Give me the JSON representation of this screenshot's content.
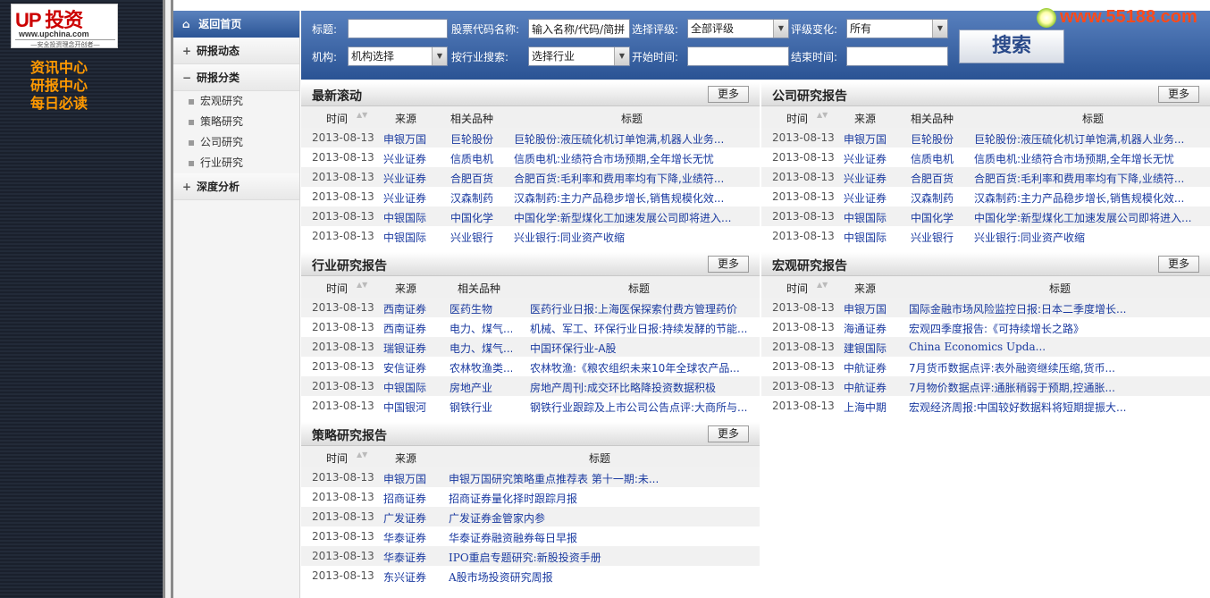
{
  "logo": {
    "brand_cn": "投资",
    "url": "www.upchina.com",
    "slogan": "—安全投资理念开创者—"
  },
  "left_nav": [
    "资讯中心",
    "研报中心",
    "每日必读"
  ],
  "brand_site": "www.55188.com",
  "menu": {
    "home": "返回首页",
    "groups": [
      {
        "label": "研报动态",
        "sign": "+"
      },
      {
        "label": "研报分类",
        "sign": "−"
      }
    ],
    "subitems": [
      "宏观研究",
      "策略研究",
      "公司研究",
      "行业研究"
    ],
    "deep": {
      "label": "深度分析",
      "sign": "+"
    }
  },
  "search": {
    "title_label": "标题:",
    "stock_label": "股票代码名称:",
    "stock_placeholder": "输入名称/代码/简拼",
    "rating_label": "选择评级:",
    "rating_value": "全部评级",
    "rating_change_label": "评级变化:",
    "rating_change_value": "所有",
    "org_label": "机构:",
    "org_value": "机构选择",
    "industry_label": "按行业搜索:",
    "industry_value": "选择行业",
    "start_label": "开始时间:",
    "end_label": "结束时间:",
    "button": "搜索"
  },
  "more_label": "更多",
  "headers": {
    "time": "时间",
    "source": "来源",
    "product": "相关品种",
    "title": "标题"
  },
  "panels": {
    "latest": {
      "title": "最新滚动",
      "rows": [
        {
          "date": "2013-08-13",
          "source": "申银万国",
          "product": "巨轮股份",
          "title": "巨轮股份:液压硫化机订单饱满,机器人业务..."
        },
        {
          "date": "2013-08-13",
          "source": "兴业证券",
          "product": "信质电机",
          "title": "信质电机:业绩符合市场预期,全年增长无忧"
        },
        {
          "date": "2013-08-13",
          "source": "兴业证券",
          "product": "合肥百货",
          "title": "合肥百货:毛利率和费用率均有下降,业绩符..."
        },
        {
          "date": "2013-08-13",
          "source": "兴业证券",
          "product": "汉森制药",
          "title": "汉森制药:主力产品稳步增长,销售规模化效..."
        },
        {
          "date": "2013-08-13",
          "source": "中银国际",
          "product": "中国化学",
          "title": "中国化学:新型煤化工加速发展公司即将进入..."
        },
        {
          "date": "2013-08-13",
          "source": "中银国际",
          "product": "兴业银行",
          "title": "兴业银行:同业资产收缩"
        }
      ]
    },
    "company": {
      "title": "公司研究报告",
      "rows": [
        {
          "date": "2013-08-13",
          "source": "申银万国",
          "product": "巨轮股份",
          "title": "巨轮股份:液压硫化机订单饱满,机器人业务..."
        },
        {
          "date": "2013-08-13",
          "source": "兴业证券",
          "product": "信质电机",
          "title": "信质电机:业绩符合市场预期,全年增长无忧"
        },
        {
          "date": "2013-08-13",
          "source": "兴业证券",
          "product": "合肥百货",
          "title": "合肥百货:毛利率和费用率均有下降,业绩符..."
        },
        {
          "date": "2013-08-13",
          "source": "兴业证券",
          "product": "汉森制药",
          "title": "汉森制药:主力产品稳步增长,销售规模化效..."
        },
        {
          "date": "2013-08-13",
          "source": "中银国际",
          "product": "中国化学",
          "title": "中国化学:新型煤化工加速发展公司即将进入..."
        },
        {
          "date": "2013-08-13",
          "source": "中银国际",
          "product": "兴业银行",
          "title": "兴业银行:同业资产收缩"
        }
      ]
    },
    "industry": {
      "title": "行业研究报告",
      "rows": [
        {
          "date": "2013-08-13",
          "source": "西南证券",
          "product": "医药生物",
          "title": "医药行业日报:上海医保探索付费方管理药价"
        },
        {
          "date": "2013-08-13",
          "source": "西南证券",
          "product": "电力、煤气...",
          "title": "机械、军工、环保行业日报:持续发酵的节能..."
        },
        {
          "date": "2013-08-13",
          "source": "瑞银证券",
          "product": "电力、煤气...",
          "title": "中国环保行业-A股"
        },
        {
          "date": "2013-08-13",
          "source": "安信证券",
          "product": "农林牧渔类...",
          "title": "农林牧渔:《粮农组织未来10年全球农产品..."
        },
        {
          "date": "2013-08-13",
          "source": "中银国际",
          "product": "房地产业",
          "title": "房地产周刊:成交环比略降投资数据积极"
        },
        {
          "date": "2013-08-13",
          "source": "中国银河",
          "product": "钢铁行业",
          "title": "钢铁行业跟踪及上市公司公告点评:大商所与..."
        }
      ]
    },
    "macro": {
      "title": "宏观研究报告",
      "rows": [
        {
          "date": "2013-08-13",
          "source": "申银万国",
          "title": "国际金融市场风险监控日报:日本二季度增长..."
        },
        {
          "date": "2013-08-13",
          "source": "海通证券",
          "title": "宏观四季度报告:《可持续增长之路》"
        },
        {
          "date": "2013-08-13",
          "source": "建银国际",
          "title": "China Economics Upda..."
        },
        {
          "date": "2013-08-13",
          "source": "中航证券",
          "title": "7月货币数据点评:表外融资继续压缩,货币..."
        },
        {
          "date": "2013-08-13",
          "source": "中航证券",
          "title": "7月物价数据点评:通胀稍弱于预期,控通胀..."
        },
        {
          "date": "2013-08-13",
          "source": "上海中期",
          "title": "宏观经济周报:中国较好数据料将短期提振大..."
        }
      ]
    },
    "strategy": {
      "title": "策略研究报告",
      "rows": [
        {
          "date": "2013-08-13",
          "source": "申银万国",
          "title": "申银万国研究策略重点推荐表 第十一期:未..."
        },
        {
          "date": "2013-08-13",
          "source": "招商证券",
          "title": "招商证券量化择时跟踪月报"
        },
        {
          "date": "2013-08-13",
          "source": "广发证券",
          "title": "广发证券金管家内参"
        },
        {
          "date": "2013-08-13",
          "source": "华泰证券",
          "title": "华泰证券融资融券每日早报"
        },
        {
          "date": "2013-08-13",
          "source": "华泰证券",
          "title": "IPO重启专题研究:新股投资手册"
        },
        {
          "date": "2013-08-13",
          "source": "东兴证券",
          "title": "A股市场投资研究周报"
        }
      ]
    }
  }
}
